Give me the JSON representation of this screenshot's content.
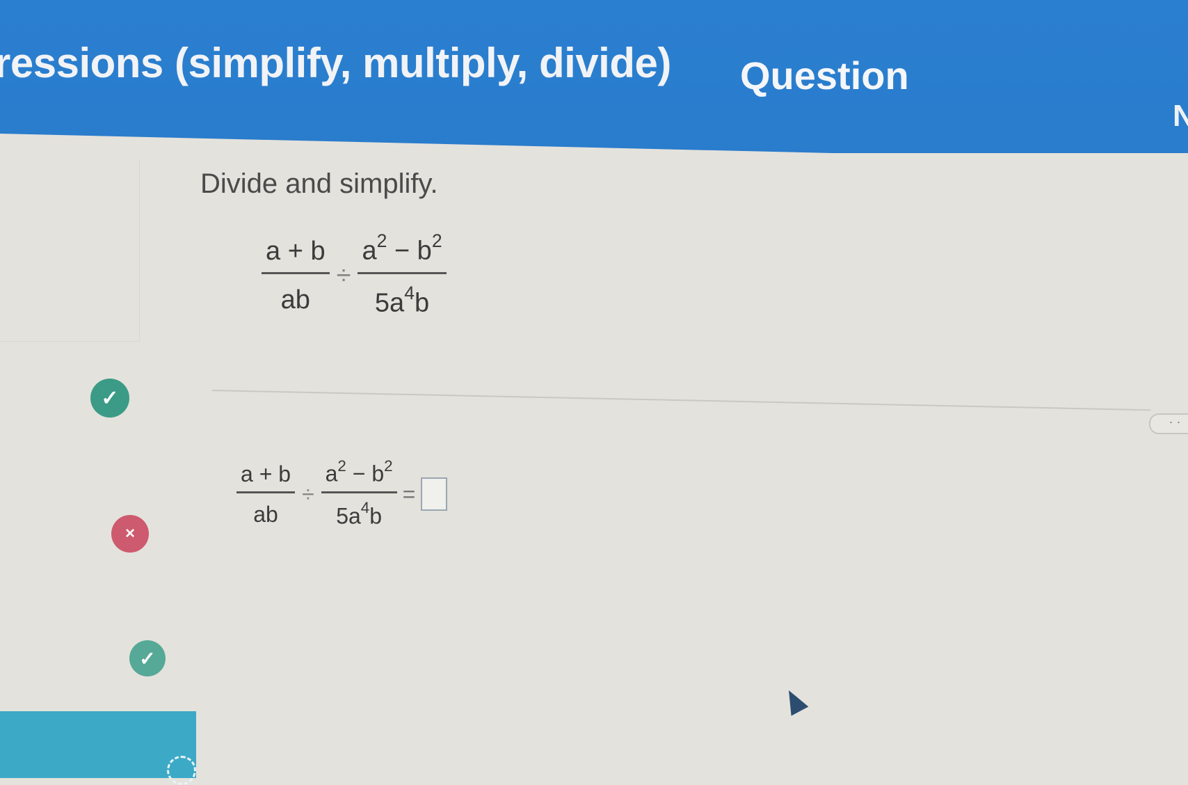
{
  "header": {
    "title": "ressions (simplify, multiply, divide)",
    "question_label": "Question",
    "trailing_letter": "N"
  },
  "problem": {
    "instruction": "Divide and simplify.",
    "expression": {
      "left_numerator": "a + b",
      "left_denominator": "ab",
      "operator": "÷",
      "right_numerator_a": "a",
      "right_numerator_a_exp": "2",
      "right_numerator_minus": " − b",
      "right_numerator_b_exp": "2",
      "right_denominator_base": "5a",
      "right_denominator_exp": "4",
      "right_denominator_tail": "b"
    },
    "equals": "="
  },
  "more_button": "· ·",
  "status_icons": {
    "check": "✓",
    "cross": "×"
  },
  "colors": {
    "header_blue": "#2b7fd0",
    "correct_green": "#3b9b86",
    "incorrect_red": "#cd5a6e",
    "tile_teal": "#3ca9c7"
  },
  "icons": {
    "correct": "check-circle-icon",
    "incorrect": "x-circle-icon",
    "loading": "spinner-icon",
    "pointer": "mouse-cursor-icon"
  }
}
